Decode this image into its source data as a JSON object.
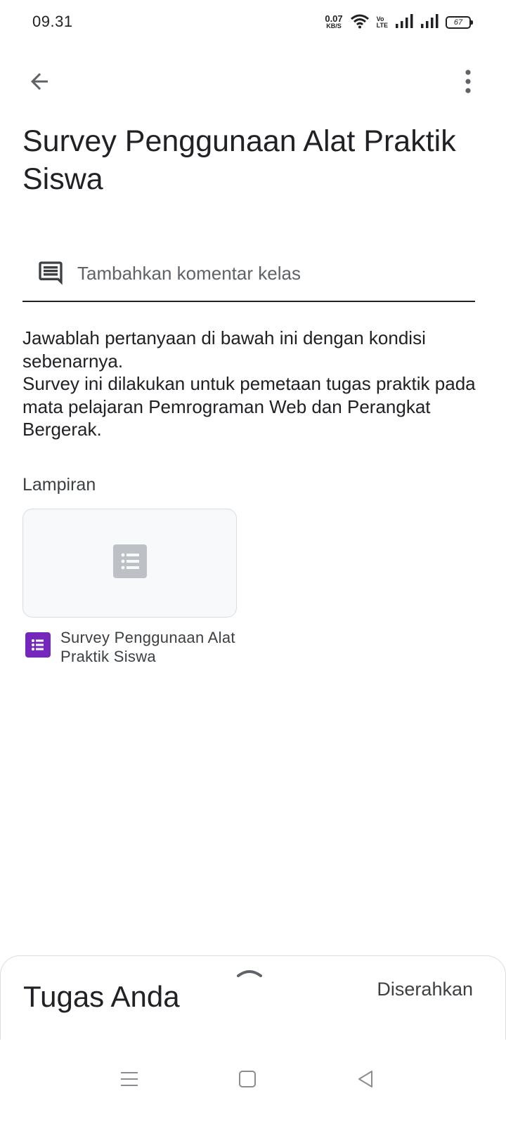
{
  "status_bar": {
    "time": "09.31",
    "net_speed_value": "0.07",
    "net_speed_unit": "KB/S",
    "volte_top": "Vo",
    "volte_bottom": "LTE",
    "battery_level": "67",
    "icons": [
      "wifi-icon",
      "volte-icon",
      "signal-icon",
      "signal-icon",
      "battery-icon"
    ]
  },
  "app_bar": {
    "back_icon": "arrow-back-icon",
    "more_icon": "more-vert-icon"
  },
  "assignment": {
    "title": "Survey Penggunaan Alat Praktik Siswa",
    "comment_placeholder": "Tambahkan komentar kelas",
    "comment_icon": "comment-icon",
    "description": "Jawablah pertanyaan di bawah ini dengan kondisi sebenarnya.\nSurvey ini dilakukan untuk pemetaan tugas praktik pada mata pelajaran Pemrograman Web dan Perangkat Bergerak.",
    "attachments_label": "Lampiran",
    "attachments": [
      {
        "name": "Survey Penggunaan Alat Praktik Siswa",
        "type_icon": "google-forms-icon",
        "preview_icon": "list-document-icon"
      }
    ]
  },
  "bottom_sheet": {
    "title": "Tugas Anda",
    "status": "Diserahkan",
    "handle_icon": "chevron-up-icon"
  },
  "nav_bar": {
    "icons": [
      "menu-icon",
      "home-square-icon",
      "back-triangle-icon"
    ]
  },
  "colors": {
    "forms_purple": "#7627bb",
    "text_primary": "#202124",
    "text_secondary": "#5f6368",
    "card_background": "#f8f9fa"
  }
}
